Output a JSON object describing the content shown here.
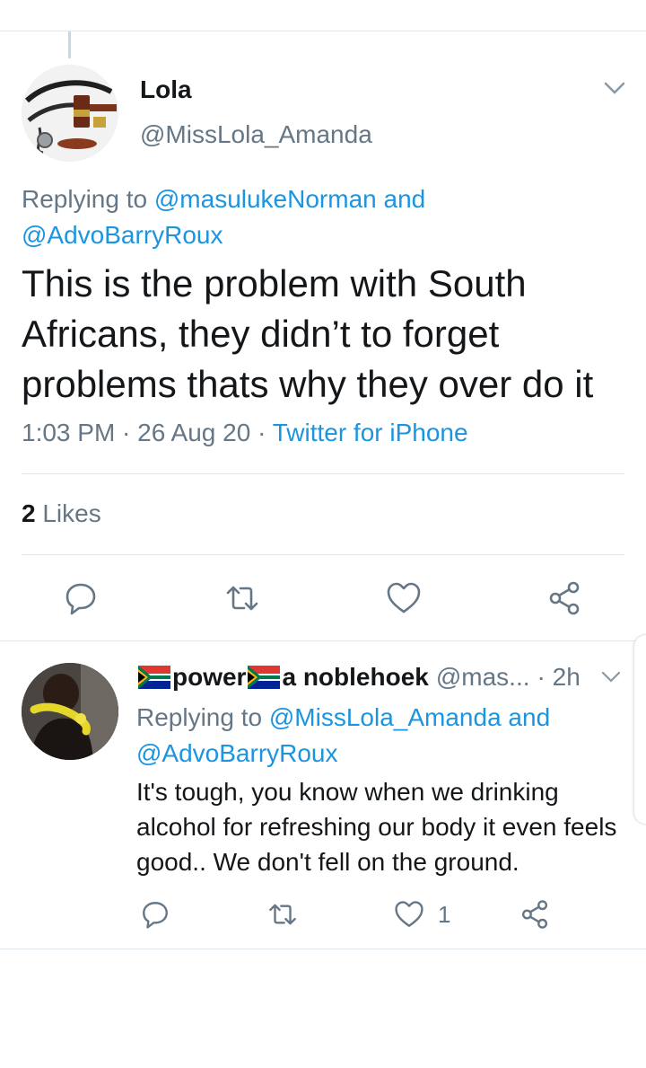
{
  "thread_line": true,
  "main_tweet": {
    "author_name": "Lola",
    "author_handle": "@MissLola_Amanda",
    "replying_prefix": "Replying to ",
    "replying_user1": "@masulukeNorman",
    "replying_and": " and",
    "replying_user2": "@AdvoBarryRoux",
    "text": "This is the problem with South Africans, they didn’t to forget problems thats why they over do it",
    "time": "1:03 PM",
    "dot1": " · ",
    "date": "26 Aug 20",
    "dot2": " · ",
    "source": "Twitter for iPhone",
    "likes_count": "2",
    "likes_label": " Likes",
    "icons": [
      "reply-icon",
      "retweet-icon",
      "like-icon",
      "share-icon"
    ]
  },
  "reply_tweet": {
    "name_part1": "power",
    "name_part2": "a noblehoek",
    "name_emoji": "south-africa-flag",
    "author_handle": "@mas...",
    "time": "· 2h",
    "replying_prefix": "Replying to ",
    "replying_user1": "@MissLola_Amanda",
    "replying_and": " and",
    "replying_user2": "@AdvoBarryRoux",
    "text": "It's tough, you know when we drinking alcohol for refreshing our body it even feels good.. We don't fell on the ground.",
    "like_count": "1",
    "icons": [
      "reply-icon",
      "retweet-icon",
      "like-icon",
      "share-icon"
    ]
  },
  "colors": {
    "link": "#1b95e0",
    "secondary": "#657786",
    "primary": "#14171a",
    "divider": "#e1e8ed"
  }
}
